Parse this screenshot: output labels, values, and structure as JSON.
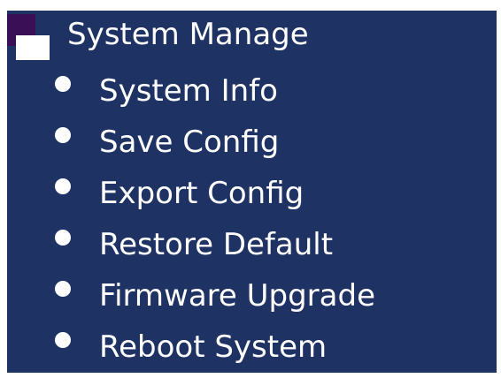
{
  "menu": {
    "header": {
      "label": "System Manage",
      "icon": "folder-open-icon"
    },
    "items": [
      {
        "label": "System Info",
        "icon": "bullet-icon"
      },
      {
        "label": "Save Config",
        "icon": "bullet-icon"
      },
      {
        "label": "Export Config",
        "icon": "bullet-icon"
      },
      {
        "label": "Restore Default",
        "icon": "bullet-icon"
      },
      {
        "label": "Firmware Upgrade",
        "icon": "bullet-icon"
      },
      {
        "label": "Reboot System",
        "icon": "bullet-icon"
      }
    ]
  },
  "colors": {
    "panel_background": "#1e3264",
    "text": "#ffffff",
    "icon_accent": "#3a0f55"
  }
}
